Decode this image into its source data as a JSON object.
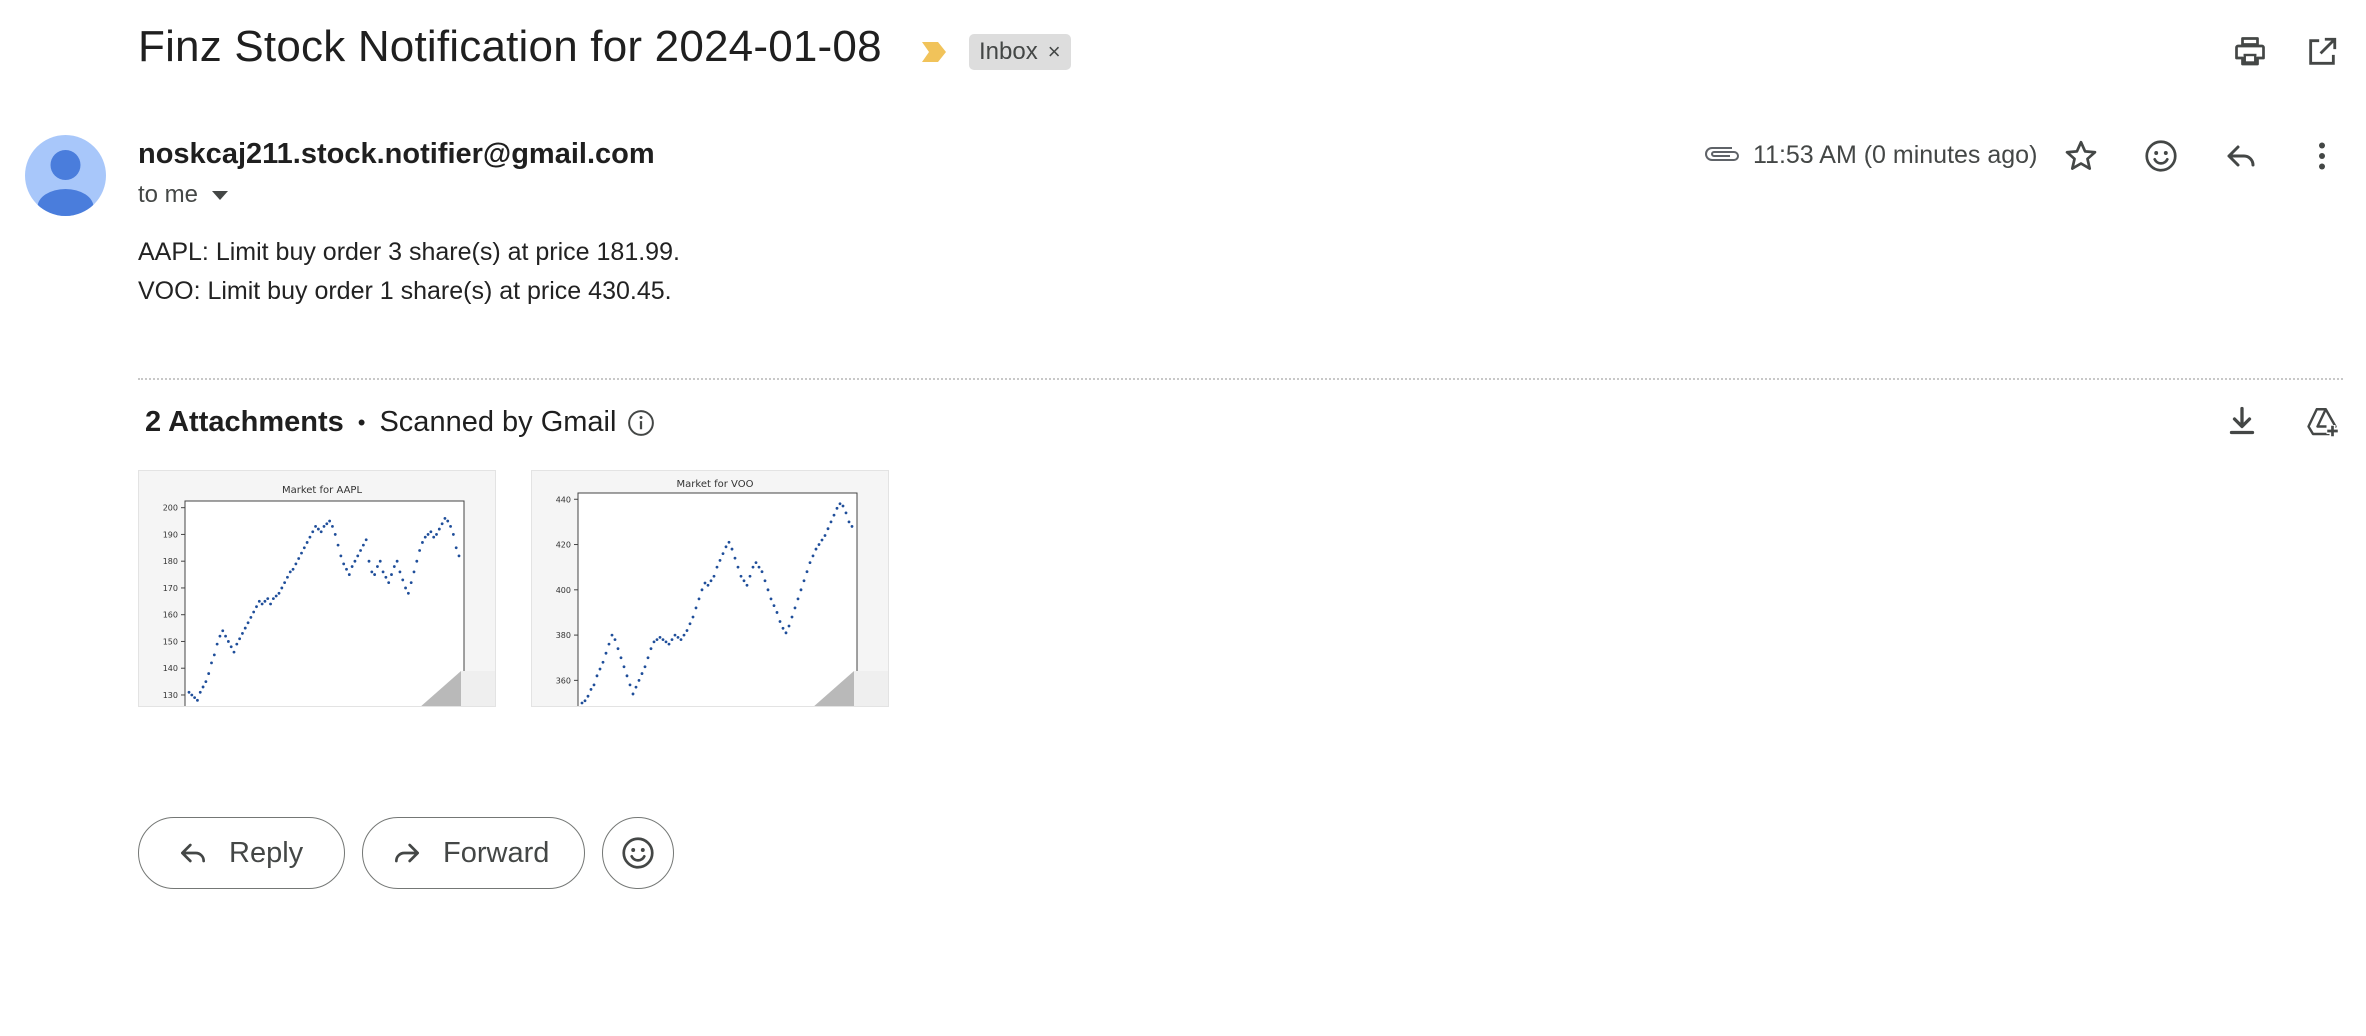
{
  "email": {
    "subject": "Finz Stock Notification for 2024-01-08",
    "label": "Inbox",
    "label_remove": "×",
    "sender": "noskcaj211.stock.notifier@gmail.com",
    "recipient": "to me",
    "timestamp": "11:53 AM (0 minutes ago)",
    "body": [
      "AAPL: Limit buy order 3 share(s) at price 181.99.",
      "VOO: Limit buy order 1 share(s) at price 430.45."
    ]
  },
  "attachments": {
    "count_label": "2 Attachments",
    "separator": "•",
    "scan_label": "Scanned by Gmail"
  },
  "actions": {
    "reply": "Reply",
    "forward": "Forward"
  },
  "icons": {
    "importance": "importance-marker-icon",
    "print": "print-icon",
    "open_new_window": "open-in-new-icon",
    "attachment": "paperclip-icon",
    "star": "star-icon",
    "emoji": "emoji-icon",
    "reply": "reply-icon",
    "more": "more-vert-icon",
    "download": "download-icon",
    "drive": "add-to-drive-icon",
    "info": "info-icon"
  },
  "colors": {
    "importance": "#f1c35a",
    "avatar_bg": "#a8c7fa",
    "avatar_fg": "#4a7ddc",
    "chart_points": "#1f4e9a"
  },
  "chart_data": [
    {
      "type": "scatter",
      "title": "Market for AAPL",
      "ylim": [
        127,
        201
      ],
      "yticks": [
        130,
        140,
        150,
        160,
        170,
        180,
        190,
        200
      ],
      "y": [
        131,
        130,
        129,
        128,
        131,
        133,
        135,
        138,
        142,
        145,
        149,
        152,
        154,
        152,
        150,
        148,
        146,
        149,
        151,
        153,
        155,
        157,
        159,
        161,
        163,
        165,
        164,
        165,
        166,
        164,
        166,
        167,
        168,
        170,
        172,
        174,
        176,
        177,
        179,
        181,
        183,
        185,
        187,
        189,
        191,
        193,
        192,
        191,
        193,
        194,
        195,
        193,
        190,
        186,
        182,
        179,
        177,
        175,
        178,
        180,
        182,
        184,
        186,
        188,
        180,
        176,
        175,
        178,
        180,
        176,
        174,
        172,
        175,
        178,
        180,
        176,
        173,
        170,
        168,
        172,
        176,
        180,
        184,
        187,
        189,
        190,
        191,
        189,
        190,
        192,
        194,
        196,
        195,
        193,
        190,
        185,
        182
      ]
    },
    {
      "type": "scatter",
      "title": "Market for VOO",
      "ylim": [
        350,
        441
      ],
      "yticks": [
        360,
        380,
        400,
        420,
        440
      ],
      "y": [
        350,
        351,
        353,
        356,
        358,
        362,
        365,
        368,
        372,
        376,
        380,
        378,
        374,
        370,
        366,
        362,
        358,
        354,
        357,
        360,
        363,
        366,
        370,
        374,
        377,
        378,
        379,
        378,
        377,
        376,
        378,
        380,
        379,
        378,
        380,
        382,
        385,
        388,
        392,
        396,
        400,
        403,
        402,
        404,
        406,
        410,
        413,
        416,
        419,
        421,
        418,
        414,
        410,
        406,
        404,
        402,
        406,
        410,
        412,
        410,
        408,
        404,
        400,
        396,
        393,
        390,
        386,
        383,
        381,
        384,
        388,
        392,
        396,
        400,
        404,
        408,
        412,
        415,
        418,
        420,
        422,
        424,
        427,
        430,
        433,
        436,
        438,
        437,
        434,
        430,
        428
      ]
    }
  ]
}
